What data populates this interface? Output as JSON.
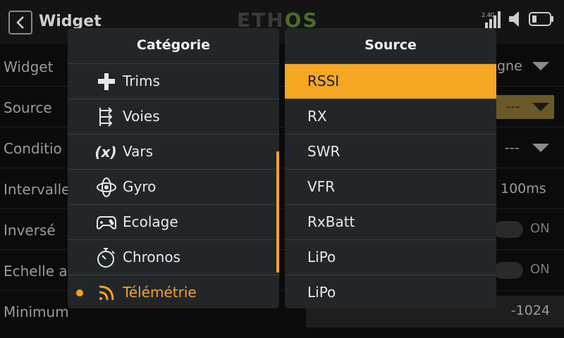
{
  "header": {
    "title": "Widget",
    "logo_main": "ETH",
    "logo_os": "OS",
    "rx_label": "2.4G"
  },
  "background": {
    "rows": [
      {
        "label": "Widget",
        "value": "gne"
      },
      {
        "label": "Source",
        "value": "---"
      },
      {
        "label": "Conditio",
        "value": "---"
      },
      {
        "label": "Intervalle",
        "value": "100ms"
      },
      {
        "label": "Inversé",
        "value": "ON"
      },
      {
        "label": "Echelle au",
        "value": "ON"
      },
      {
        "label": "Minimum",
        "value": "-1024"
      }
    ]
  },
  "category_panel": {
    "title": "Catégorie",
    "items": [
      {
        "label": "Trims",
        "icon": "trims-icon"
      },
      {
        "label": "Voies",
        "icon": "channels-icon"
      },
      {
        "label": "Vars",
        "icon": "variable-icon"
      },
      {
        "label": "Gyro",
        "icon": "gyro-icon"
      },
      {
        "label": "Ecolage",
        "icon": "gamepad-icon"
      },
      {
        "label": "Chronos",
        "icon": "stopwatch-icon"
      },
      {
        "label": "Télémétrie",
        "icon": "signal-icon"
      }
    ],
    "selected_index": 6
  },
  "source_panel": {
    "title": "Source",
    "items": [
      "RSSI",
      "RX",
      "SWR",
      "VFR",
      "RxBatt",
      "LiPo",
      "LiPo"
    ],
    "active_index": 0
  },
  "colors": {
    "accent": "#f5a623",
    "panel": "#232629",
    "background": "#0b0b0b"
  }
}
